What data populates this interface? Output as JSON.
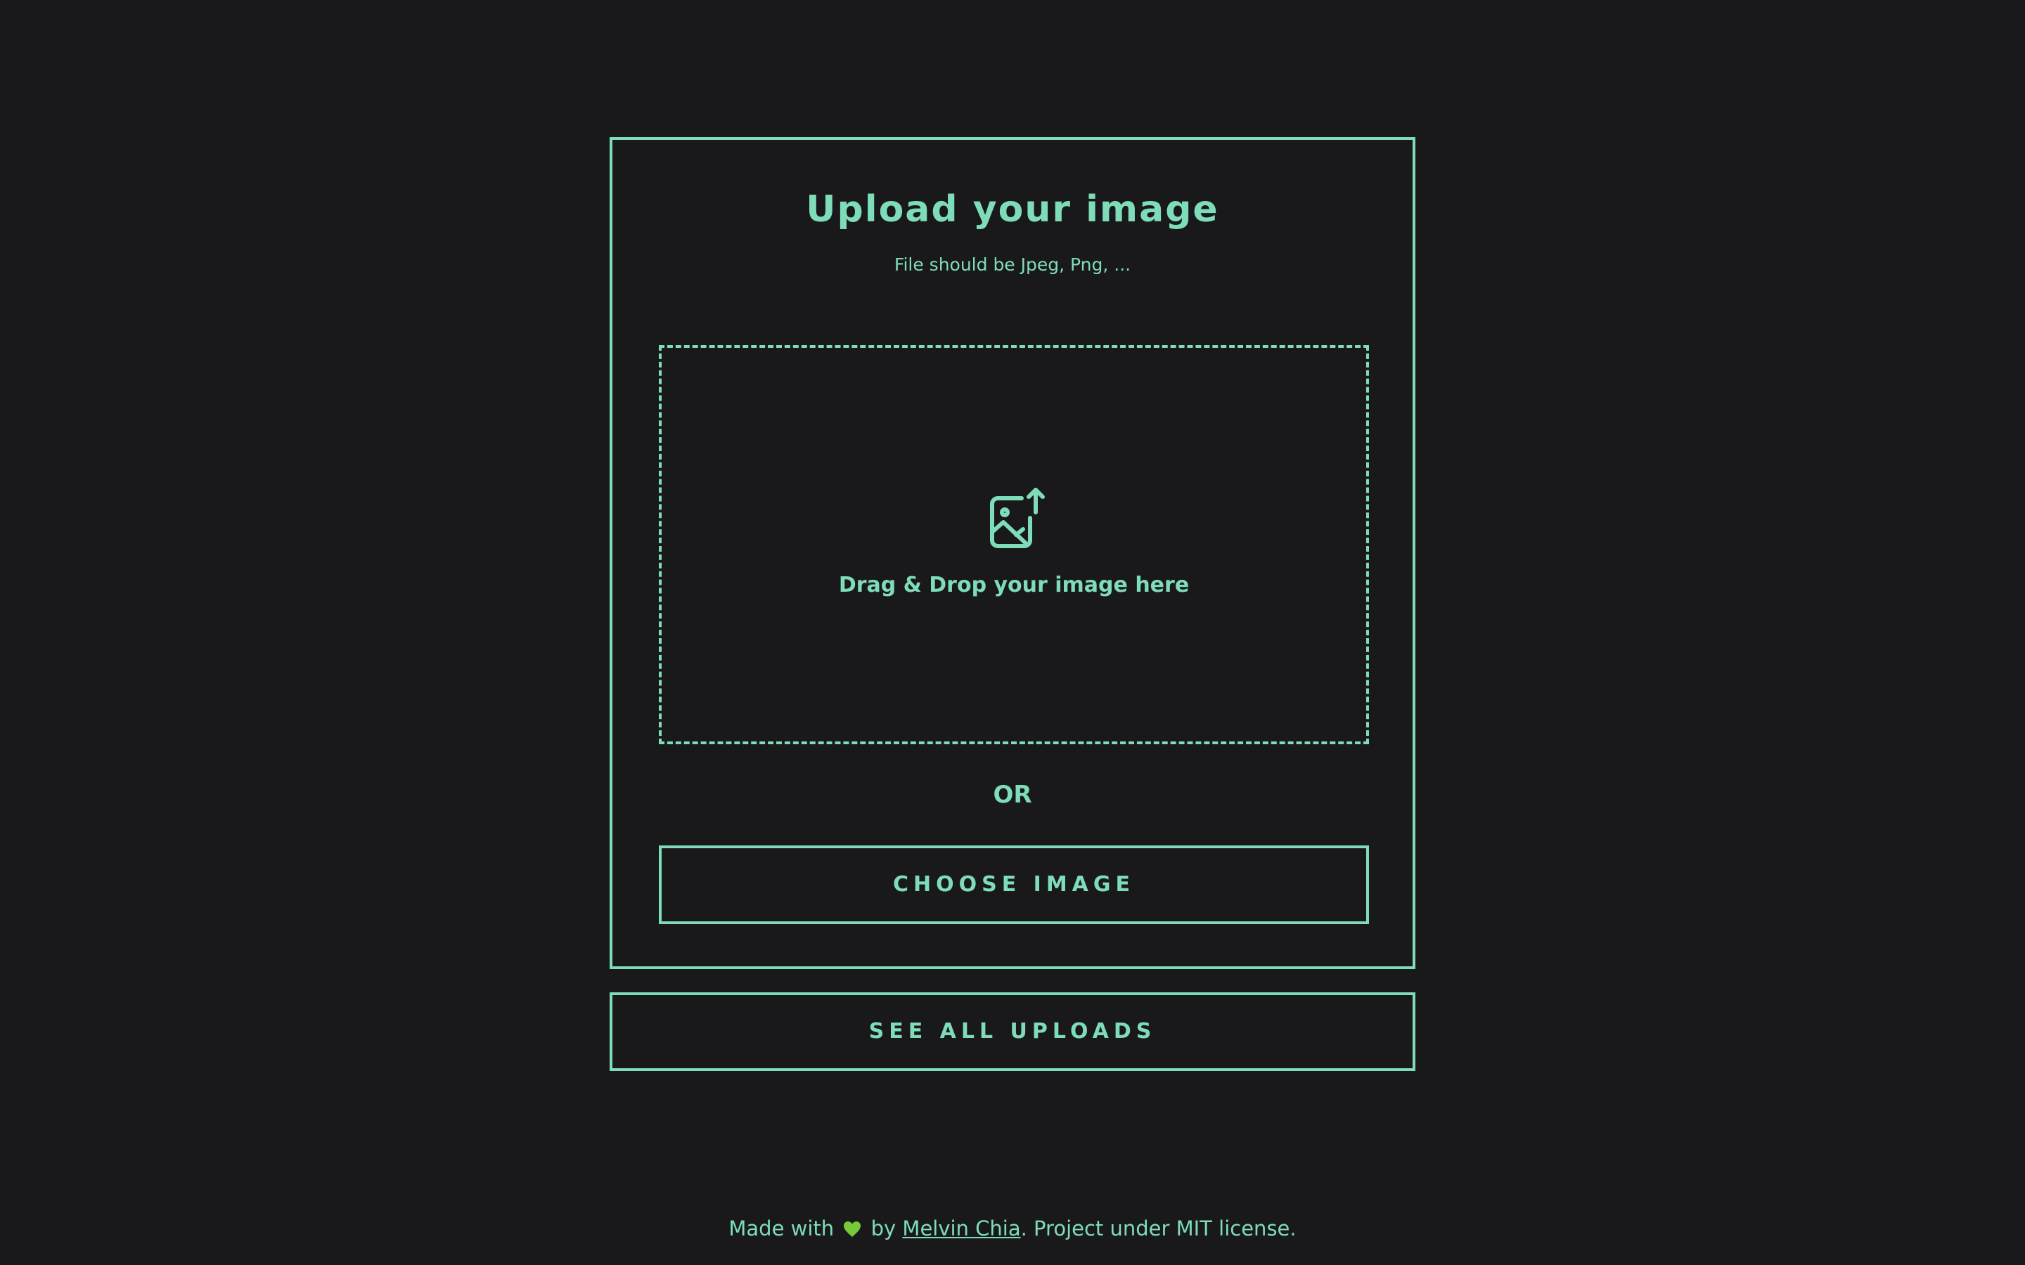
{
  "upload_card": {
    "title": "Upload your image",
    "subtitle": "File should be Jpeg, Png, ...",
    "dropzone": {
      "icon": "image-upload-icon",
      "label": "Drag & Drop your image here"
    },
    "separator": "OR",
    "choose_button_label": "CHOOSE IMAGE"
  },
  "see_all_button_label": "SEE ALL UPLOADS",
  "footer": {
    "prefix": "Made with",
    "heart_icon": "green-heart-icon",
    "by": "by",
    "author_link": "Melvin Chia",
    "suffix": ". Project under MIT license."
  },
  "colors": {
    "background": "#19191b",
    "accent": "#7edcb9",
    "heart": "#77c93a"
  }
}
